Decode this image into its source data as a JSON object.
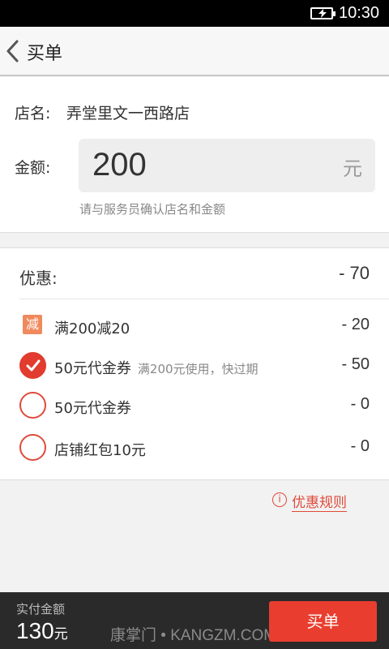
{
  "status_bar": {
    "time": "10:30"
  },
  "header": {
    "title": "买单"
  },
  "store": {
    "label": "店名:",
    "name": "弄堂里文一西路店"
  },
  "amount": {
    "label": "金额:",
    "value": "200",
    "unit": "元",
    "hint": "请与服务员确认店名和金额"
  },
  "discount": {
    "label": "优惠:",
    "total": "- 70",
    "items": [
      {
        "type": "reduce",
        "badge": "减",
        "label": "满200减20",
        "note": "",
        "value": "- 20",
        "checked": true
      },
      {
        "type": "voucher",
        "label": "50元代金券",
        "note": "满200元使用，快过期",
        "value": "- 50",
        "checked": true
      },
      {
        "type": "voucher",
        "label": "50元代金券",
        "note": "",
        "value": "- 0",
        "checked": false
      },
      {
        "type": "redpacket",
        "label": "店铺红包10元",
        "note": "",
        "value": "- 0",
        "checked": false
      }
    ]
  },
  "rules": {
    "icon": "info-icon",
    "label": "优惠规则"
  },
  "footer": {
    "pay_label": "实付金额",
    "pay_amount": "130",
    "pay_unit": "元",
    "watermark": "康掌门 • KANGZM.COM",
    "buy_label": "买单"
  },
  "colors": {
    "accent": "#e93e2f",
    "badge": "#f08a5d",
    "footer_bg": "#2a2a2a"
  }
}
